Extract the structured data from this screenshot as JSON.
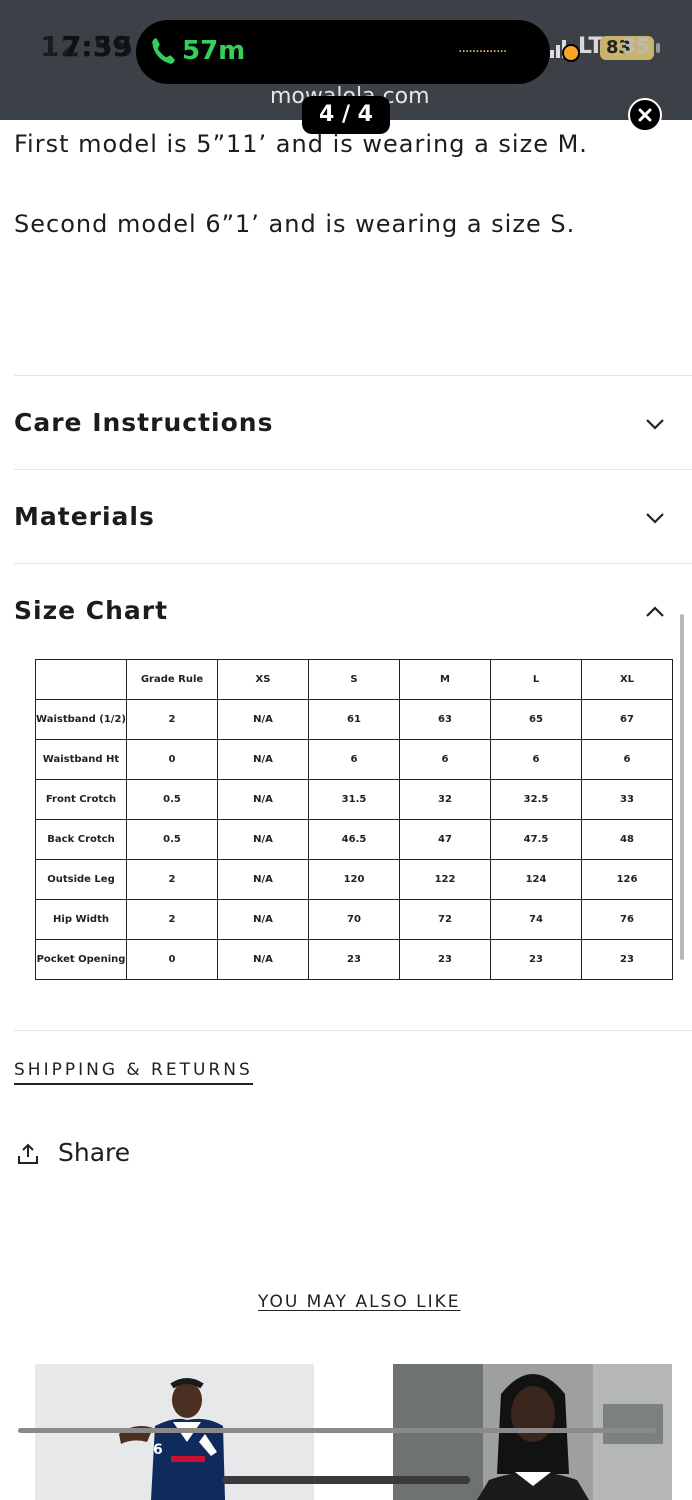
{
  "status_bar": {
    "time_ghost": "12:55",
    "time": "7:39",
    "call_duration": "57m",
    "dots": "..............",
    "network": "LTE",
    "battery_a": "83",
    "battery_b": "35"
  },
  "viewer": {
    "domain": "mowalola.com",
    "page_indicator": "4 / 4"
  },
  "description": {
    "line1": "First model is 5”11’ and is wearing a size M.",
    "line2": "Second model 6”1’ and is wearing a size S."
  },
  "accordions": [
    {
      "label": "Care Instructions",
      "state": "collapsed"
    },
    {
      "label": "Materials",
      "state": "collapsed"
    },
    {
      "label": "Size Chart",
      "state": "expanded"
    }
  ],
  "size_chart": {
    "headers": [
      "",
      "Grade Rule",
      "XS",
      "S",
      "M",
      "L",
      "XL"
    ],
    "rows": [
      [
        "Waistband (1/2)",
        "2",
        "N/A",
        "61",
        "63",
        "65",
        "67"
      ],
      [
        "Waistband Ht",
        "0",
        "N/A",
        "6",
        "6",
        "6",
        "6"
      ],
      [
        "Front Crotch",
        "0.5",
        "N/A",
        "31.5",
        "32",
        "32.5",
        "33"
      ],
      [
        "Back Crotch",
        "0.5",
        "N/A",
        "46.5",
        "47",
        "47.5",
        "48"
      ],
      [
        "Outside Leg",
        "2",
        "N/A",
        "120",
        "122",
        "124",
        "126"
      ],
      [
        "Hip Width",
        "2",
        "N/A",
        "70",
        "72",
        "74",
        "76"
      ],
      [
        "Pocket Opening",
        "0",
        "N/A",
        "23",
        "23",
        "23",
        "23"
      ]
    ]
  },
  "links": {
    "shipping": "SHIPPING & RETURNS",
    "share": "Share",
    "also_like": "YOU MAY ALSO LIKE"
  },
  "product_cards": [
    {
      "shirt_number": "6"
    },
    {
      "shirt_number": ""
    }
  ],
  "colors": {
    "status_bar_bg": "#3b4146",
    "call_green": "#33d15b",
    "text": "#1c1c1c"
  }
}
